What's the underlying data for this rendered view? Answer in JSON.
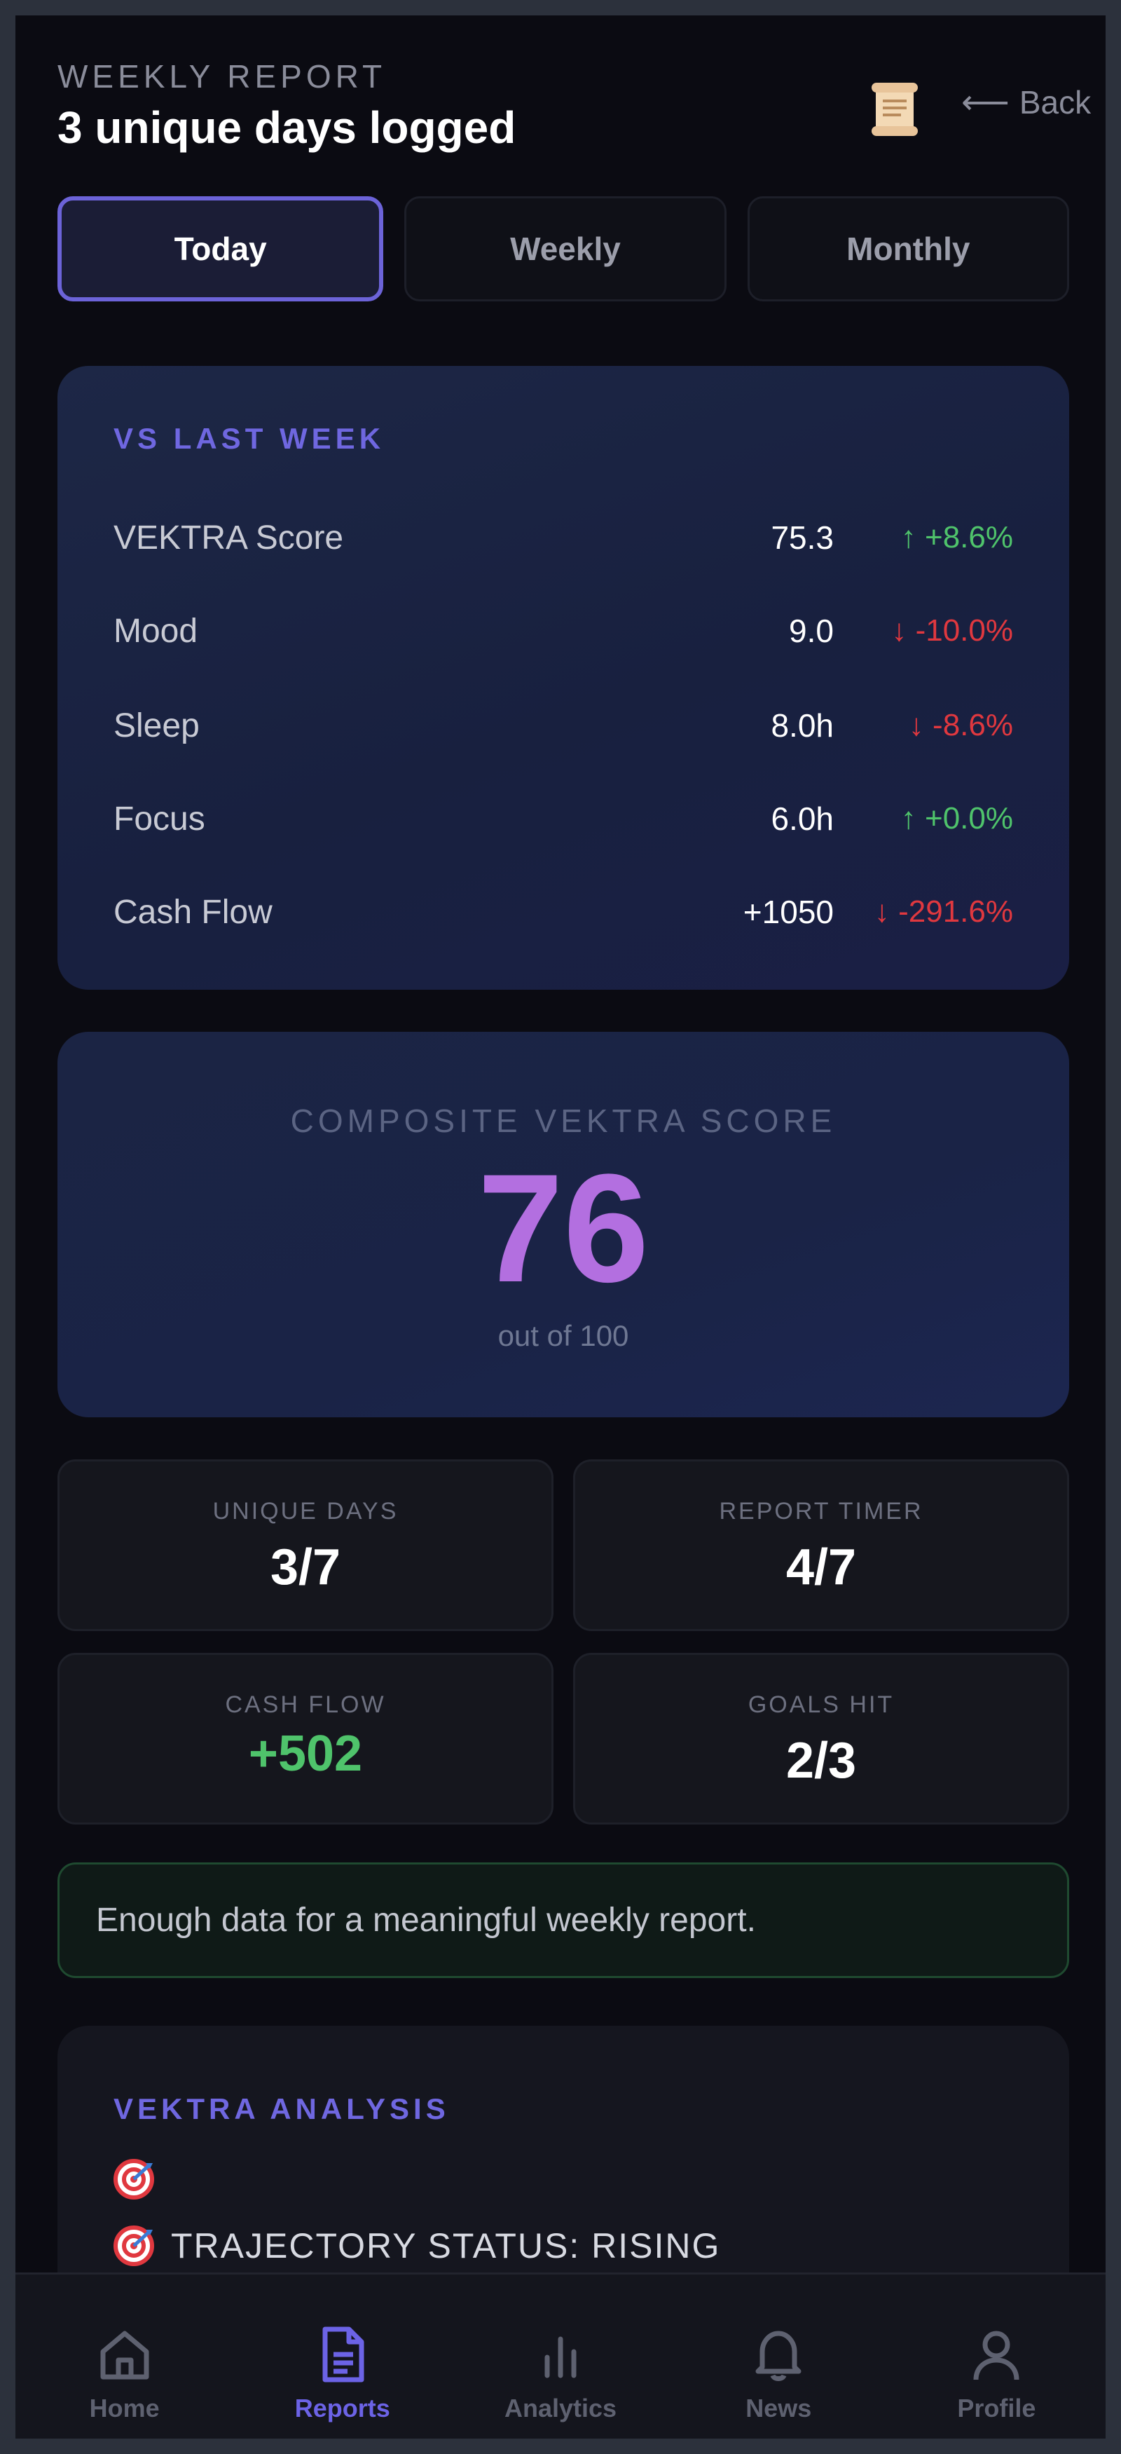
{
  "header": {
    "eyebrow": "WEEKLY REPORT",
    "title": "3 unique days logged",
    "back_label": "Back",
    "back_arrow": "⟵"
  },
  "tabs": [
    {
      "label": "Today",
      "active": true
    },
    {
      "label": "Weekly",
      "active": false
    },
    {
      "label": "Monthly",
      "active": false
    }
  ],
  "comparison": {
    "label": "VS LAST WEEK",
    "rows": [
      {
        "label": "VEKTRA Score",
        "value": "75.3",
        "delta": "+8.6%",
        "direction": "up"
      },
      {
        "label": "Mood",
        "value": "9.0",
        "delta": "-10.0%",
        "direction": "down"
      },
      {
        "label": "Sleep",
        "value": "8.0h",
        "delta": "-8.6%",
        "direction": "down"
      },
      {
        "label": "Focus",
        "value": "6.0h",
        "delta": "+0.0%",
        "direction": "up"
      },
      {
        "label": "Cash Flow",
        "value": "+1050",
        "delta": "-291.6%",
        "direction": "down"
      }
    ]
  },
  "composite": {
    "label": "COMPOSITE VEKTRA SCORE",
    "score": "76",
    "sub": "out of 100"
  },
  "stats": {
    "unique_days": {
      "label": "UNIQUE DAYS",
      "value": "3/7"
    },
    "report_timer": {
      "label": "REPORT TIMER",
      "value": "4/7"
    },
    "cash_flow": {
      "label": "CASH FLOW",
      "value": "+502"
    },
    "goals_hit": {
      "label": "GOALS HIT",
      "value": "2/3"
    }
  },
  "notice": "Enough data for a meaningful weekly report.",
  "analysis": {
    "label": "VEKTRA ANALYSIS",
    "lines": [
      "",
      "TRAJECTORY STATUS: RISING"
    ]
  },
  "nav": [
    {
      "label": "Home",
      "icon": "home-icon"
    },
    {
      "label": "Reports",
      "icon": "document-icon",
      "active": true
    },
    {
      "label": "Analytics",
      "icon": "bar-chart-icon"
    },
    {
      "label": "News",
      "icon": "bell-icon"
    },
    {
      "label": "Profile",
      "icon": "user-icon"
    }
  ],
  "colors": {
    "accent": "#6c63e6",
    "score": "#b36fe0",
    "up": "#4fc36b",
    "down": "#e0383f",
    "background": "#0b0b12"
  }
}
